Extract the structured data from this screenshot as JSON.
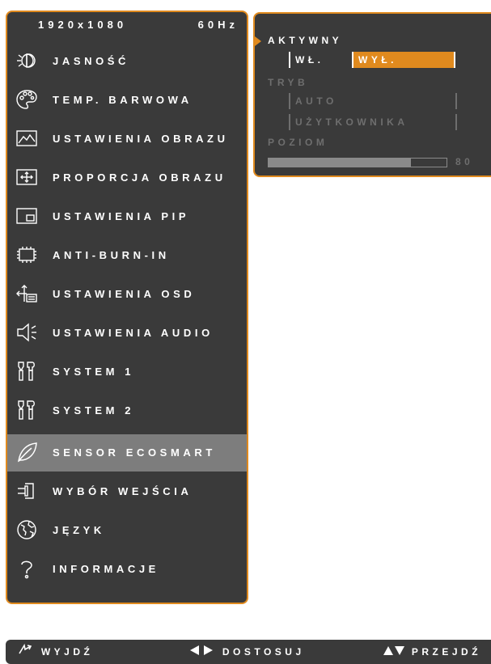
{
  "status": {
    "resolution": "1920x1080",
    "refresh": "60Hz"
  },
  "menu": [
    {
      "label": "JASNOŚĆ",
      "icon": "brightness-icon"
    },
    {
      "label": "TEMP. BARWOWA",
      "icon": "palette-icon"
    },
    {
      "label": "USTAWIENIA OBRAZU",
      "icon": "image-settings-icon"
    },
    {
      "label": "PROPORCJA OBRAZU",
      "icon": "aspect-ratio-icon"
    },
    {
      "label": "USTAWIENIA PIP",
      "icon": "pip-icon"
    },
    {
      "label": "ANTI-BURN-IN",
      "icon": "chip-icon"
    },
    {
      "label": "USTAWIENIA OSD",
      "icon": "osd-icon"
    },
    {
      "label": "USTAWIENIA AUDIO",
      "icon": "speaker-icon"
    },
    {
      "label": "SYSTEM 1",
      "icon": "tools-icon"
    },
    {
      "label": "SYSTEM 2",
      "icon": "tools-icon"
    },
    {
      "label": "SENSOR ECOSMART",
      "icon": "leaf-icon",
      "selected": true
    },
    {
      "label": "WYBÓR WEJŚCIA",
      "icon": "input-icon"
    },
    {
      "label": "JĘZYK",
      "icon": "globe-icon"
    },
    {
      "label": "INFORMACJE",
      "icon": "question-icon"
    }
  ],
  "submenu": {
    "active_label": "AKTYWNY",
    "active_options": [
      "WŁ.",
      "WYŁ."
    ],
    "active_selected": "WYŁ.",
    "mode_label": "TRYB",
    "mode_options": [
      "AUTO",
      "UŻYTKOWNIKA"
    ],
    "level_label": "POZIOM",
    "level_value": "80",
    "level_fraction": 0.8
  },
  "footer": {
    "exit_label": "WYJDŹ",
    "adjust_label": "DOSTOSUJ",
    "navigate_label": "PRZEJDŹ"
  },
  "colors": {
    "accent": "#e08a1e",
    "panel": "#3a3a3a",
    "selected_row": "#7d7d7d",
    "dim_text": "#6e6e6e"
  }
}
